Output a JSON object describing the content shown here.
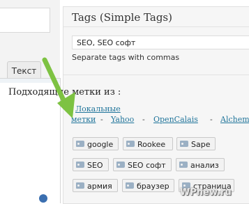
{
  "editor": {
    "tab_text": "Текст"
  },
  "tags_panel": {
    "title": "Tags (Simple Tags)",
    "input_value": "SEO, SEO софт",
    "hint": "Separate tags with commas"
  },
  "suggestions": {
    "title": "Подходящие метки из :",
    "sources": {
      "local_line1": "Локальные",
      "local_line2": "метки",
      "sep": "-",
      "yahoo": "Yahoo",
      "opencalais": "OpenCalais",
      "alchemy": "Alchemy"
    },
    "tags": [
      "google",
      "Rookee",
      "Sape",
      "SEO",
      "SEO софт",
      "анализ",
      "армия",
      "браузер",
      "страница"
    ]
  },
  "watermark": "WPnew.ru",
  "colors": {
    "link": "#21759b",
    "arrow": "#7dc242",
    "chip_icon": "#9bb0c4"
  }
}
